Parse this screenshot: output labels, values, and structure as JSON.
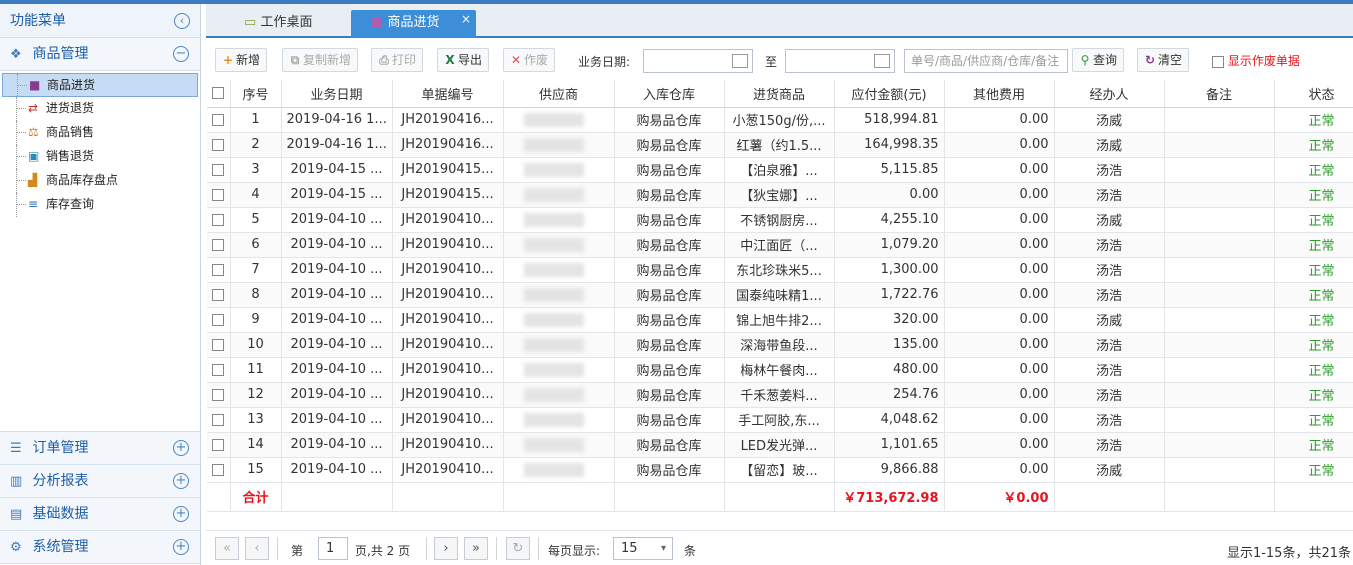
{
  "sidebar": {
    "title": "功能菜单",
    "groups": [
      {
        "label": "商品管理",
        "expanded": true
      },
      {
        "label": "订单管理"
      },
      {
        "label": "分析报表"
      },
      {
        "label": "基础数据"
      },
      {
        "label": "系统管理"
      }
    ],
    "tree": [
      "商品进货",
      "进货退货",
      "商品销售",
      "销售退货",
      "商品库存盘点",
      "库存查询"
    ]
  },
  "tabs": [
    {
      "label": "工作桌面"
    },
    {
      "label": "商品进货",
      "close": "×"
    }
  ],
  "toolbar": {
    "add": "新增",
    "copy_add": "复制新增",
    "print": "打印",
    "export": "导出",
    "void": "作废",
    "date_label": "业务日期:",
    "to_label": "至",
    "search_placeholder": "单号/商品/供应商/仓库/备注",
    "search": "查询",
    "clear": "清空",
    "show_void": "显示作废单据"
  },
  "table": {
    "headers": [
      "序号",
      "业务日期",
      "单据编号",
      "供应商",
      "入库仓库",
      "进货商品",
      "应付金额(元)",
      "其他费用",
      "经办人",
      "备注",
      "状态"
    ],
    "rows": [
      [
        "1",
        "2019-04-16 1...",
        "JH20190416...",
        "",
        "购易品仓库",
        "小葱150g/份,...",
        "518,994.81",
        "0.00",
        "汤威",
        "",
        "正常"
      ],
      [
        "2",
        "2019-04-16 1...",
        "JH20190416...",
        "",
        "购易品仓库",
        "红薯（约1.5...",
        "164,998.35",
        "0.00",
        "汤威",
        "",
        "正常"
      ],
      [
        "3",
        "2019-04-15 ...",
        "JH20190415...",
        "",
        "购易品仓库",
        "【泊泉雅】...",
        "5,115.85",
        "0.00",
        "汤浩",
        "",
        "正常"
      ],
      [
        "4",
        "2019-04-15 ...",
        "JH20190415...",
        "",
        "购易品仓库",
        "【狄宝娜】...",
        "0.00",
        "0.00",
        "汤浩",
        "",
        "正常"
      ],
      [
        "5",
        "2019-04-10 ...",
        "JH20190410...",
        "",
        "购易品仓库",
        "不锈钢厨房...",
        "4,255.10",
        "0.00",
        "汤威",
        "",
        "正常"
      ],
      [
        "6",
        "2019-04-10 ...",
        "JH20190410...",
        "",
        "购易品仓库",
        "中江面匠（...",
        "1,079.20",
        "0.00",
        "汤浩",
        "",
        "正常"
      ],
      [
        "7",
        "2019-04-10 ...",
        "JH20190410...",
        "",
        "购易品仓库",
        "东北珍珠米5...",
        "1,300.00",
        "0.00",
        "汤浩",
        "",
        "正常"
      ],
      [
        "8",
        "2019-04-10 ...",
        "JH20190410...",
        "",
        "购易品仓库",
        "国泰纯味精1...",
        "1,722.76",
        "0.00",
        "汤浩",
        "",
        "正常"
      ],
      [
        "9",
        "2019-04-10 ...",
        "JH20190410...",
        "",
        "购易品仓库",
        "锦上旭牛排2...",
        "320.00",
        "0.00",
        "汤威",
        "",
        "正常"
      ],
      [
        "10",
        "2019-04-10 ...",
        "JH20190410...",
        "",
        "购易品仓库",
        "深海带鱼段...",
        "135.00",
        "0.00",
        "汤浩",
        "",
        "正常"
      ],
      [
        "11",
        "2019-04-10 ...",
        "JH20190410...",
        "",
        "购易品仓库",
        "梅林午餐肉...",
        "480.00",
        "0.00",
        "汤浩",
        "",
        "正常"
      ],
      [
        "12",
        "2019-04-10 ...",
        "JH20190410...",
        "",
        "购易品仓库",
        "千禾葱姜料...",
        "254.76",
        "0.00",
        "汤浩",
        "",
        "正常"
      ],
      [
        "13",
        "2019-04-10 ...",
        "JH20190410...",
        "",
        "购易品仓库",
        "手工阿胶,东...",
        "4,048.62",
        "0.00",
        "汤浩",
        "",
        "正常"
      ],
      [
        "14",
        "2019-04-10 ...",
        "JH20190410...",
        "",
        "购易品仓库",
        "LED发光弹...",
        "1,101.65",
        "0.00",
        "汤浩",
        "",
        "正常"
      ],
      [
        "15",
        "2019-04-10 ...",
        "JH20190410...",
        "",
        "购易品仓库",
        "【留恋】玻...",
        "9,866.88",
        "0.00",
        "汤威",
        "",
        "正常"
      ]
    ],
    "total_label": "合计",
    "total_amount": "￥713,672.98",
    "total_other": "￥0.00"
  },
  "pager": {
    "page_prefix": "第",
    "page": "1",
    "page_suffix": "页,共 2 页",
    "per_page_label": "每页显示:",
    "per_page": "15",
    "per_page_unit": "条",
    "summary": "显示1-15条，共21条"
  },
  "colors": {
    "accent": "#3c8ed8",
    "ok": "#2d9b2d",
    "red": "#e8141c"
  }
}
